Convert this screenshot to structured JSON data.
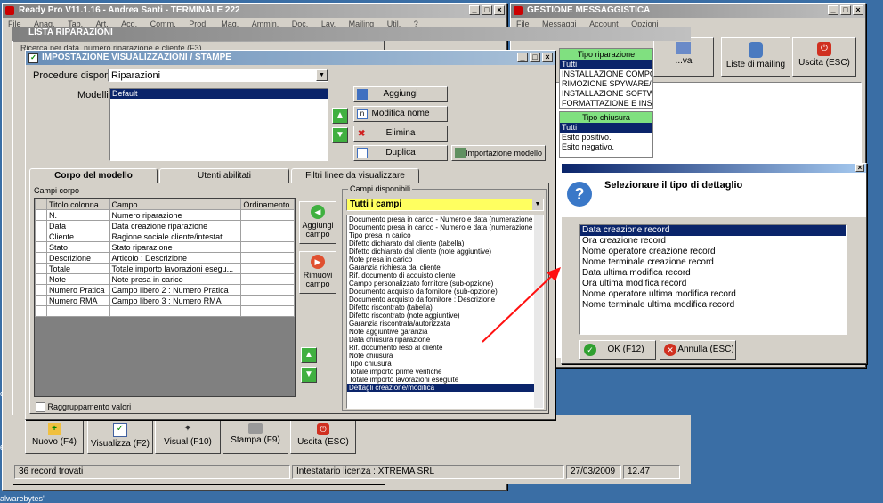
{
  "main_window": {
    "title": "Ready Pro V11.1.16 - Andrea Santi - TERMINALE 222",
    "menu": [
      "File",
      "Anag.",
      "Tab.",
      "Art.",
      "Acq.",
      "Comm.",
      "Prod.",
      "Mag.",
      "Ammin.",
      "Doc.",
      "Lav.",
      "Mailing",
      "Util.",
      "?"
    ]
  },
  "messaggistica": {
    "title": "GESTIONE MESSAGGISTICA",
    "menu": [
      "File",
      "Messaggi",
      "Account",
      "Opzioni"
    ],
    "buttons": [
      "...va",
      "Liste di mailing",
      "Uscita (ESC)"
    ]
  },
  "riparazioni": {
    "title": "LISTA RIPARAZIONI",
    "search_hint": "Ricerca per data, numero riparazione e cliente (F3)",
    "toolbar": [
      "Nuovo (F4)",
      "Visualizza (F2)",
      "Visual (F10)",
      "Stampa (F9)",
      "Uscita (ESC)"
    ],
    "status_records": "36 record trovati",
    "status_license": "Intestatario licenza : XTREMA SRL",
    "status_date": "27/03/2009",
    "status_time": "12.47"
  },
  "impostazione": {
    "title": "IMPOSTAZIONE VISUALIZZAZIONI / STAMPE",
    "procedure_label": "Procedure disponibili :",
    "procedure_value": "Riparazioni",
    "modelli_label": "Modelli :",
    "modelli": [
      "Default"
    ],
    "btn_aggiungi": "Aggiungi",
    "btn_modifica": "Modifica nome",
    "btn_elimina": "Elimina",
    "btn_duplica": "Duplica",
    "btn_importazione": "Importazione modello",
    "tabs": [
      "Corpo del modello",
      "Utenti abilitati",
      "Filtri linee da visualizzare"
    ],
    "campi_corpo_label": "Campi corpo",
    "grid_headers": [
      "Titolo colonna",
      "Campo",
      "Ordinamento"
    ],
    "grid_rows": [
      [
        "N.",
        "Numero riparazione",
        ""
      ],
      [
        "Data",
        "Data creazione riparazione",
        ""
      ],
      [
        "Cliente",
        "Ragione sociale cliente/intestat...",
        ""
      ],
      [
        "Stato",
        "Stato riparazione",
        ""
      ],
      [
        "Descrizione",
        "Articolo : Descrizione",
        ""
      ],
      [
        "Totale",
        "Totale importo lavorazioni esegu...",
        ""
      ],
      [
        "Note",
        "Note presa in carico",
        ""
      ],
      [
        "Numero Pratica",
        "Campo libero 2 : Numero Pratica",
        ""
      ],
      [
        "Numero RMA",
        "Campo libero 3 : Numero RMA",
        ""
      ]
    ],
    "btn_aggiungi_campo": [
      "Aggiungi",
      "campo"
    ],
    "btn_rimuovi_campo": [
      "Rimuovi",
      "campo"
    ],
    "raggruppamento": "Raggruppamento valori",
    "campi_disponibili_label": "Campi disponibili",
    "campi_filter": "Tutti i campi",
    "campi_disponibili": [
      "Documento presa in carico - Numero e data (numerazione",
      "Documento presa in carico - Numero e data (numerazione",
      "Tipo presa in carico",
      "Difetto dichiarato dal cliente (tabella)",
      "Difetto dichiarato dal cliente (note aggiuntive)",
      "Note presa in carico",
      "Garanzia richiesta dal cliente",
      "Rif. documento di acquisto cliente",
      "Campo personalizzato fornitore (sub-opzione)",
      "Documento acquisto da fornitore (sub-opzione)",
      "Documento acquisto da fornitore : Descrizione",
      "Difetto riscontrato (tabella)",
      "Difetto riscontrato (note aggiuntive)",
      "Garanzia riscontrata/autorizzata",
      "Note aggiuntive garanzia",
      "Data chiusura riparazione",
      "Rif. documento reso al cliente",
      "Note chiusura",
      "Tipo chiusura",
      "Totale importo prime verifiche",
      "Totale importo lavorazioni eseguite",
      "Dettagli creazione/modifica"
    ]
  },
  "tipo_riparazione": {
    "header": "Tipo riparazione",
    "items": [
      "Tutti",
      "INSTALLAZIONE COMPON",
      "RIMOZIONE SPYWARE/D",
      "INSTALLAZIONE SOFTWA",
      "FORMATTAZIONE E INST"
    ]
  },
  "tipo_chiusura": {
    "header": "Tipo chiusura",
    "items": [
      "Tutti",
      "Esito positivo.",
      "Esito negativo."
    ]
  },
  "dettaglio_dialog": {
    "title": "Selezionare il tipo di dettaglio",
    "items": [
      "Data creazione record",
      "Ora creazione record",
      "Nome operatore creazione record",
      "Nome terminale creazione record",
      "Data ultima modifica record",
      "Ora ultima modifica record",
      "Nome operatore ultima modifica record",
      "Nome terminale ultima modifica record"
    ],
    "ok": "OK (F12)",
    "cancel": "Annulla (ESC)"
  },
  "desktop": {
    "labels": [
      "ozill",
      "eam",
      "alwarebytes'"
    ]
  }
}
